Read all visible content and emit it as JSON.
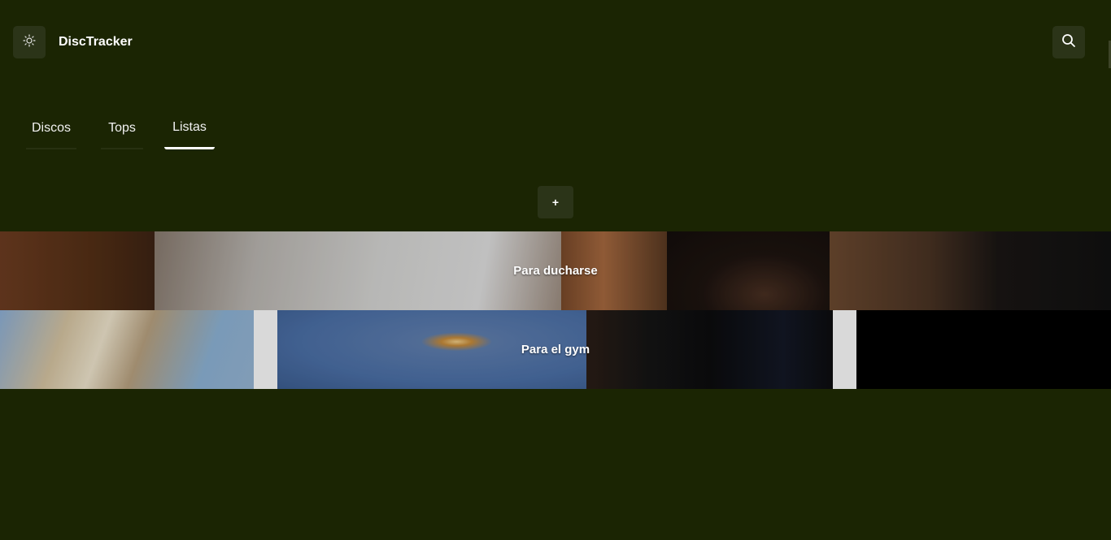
{
  "header": {
    "app_title": "DiscTracker",
    "theme_icon": "sun-icon",
    "search_icon": "search-icon"
  },
  "tabs": [
    {
      "label": "Discos",
      "active": false
    },
    {
      "label": "Tops",
      "active": false
    },
    {
      "label": "Listas",
      "active": true
    }
  ],
  "actions": {
    "add_label": "+"
  },
  "lists": [
    {
      "name": "Para ducharse"
    },
    {
      "name": "Para el gym"
    }
  ],
  "colors": {
    "background": "#1b2503",
    "button_bg": "#2b3418",
    "text": "#ffffff"
  }
}
